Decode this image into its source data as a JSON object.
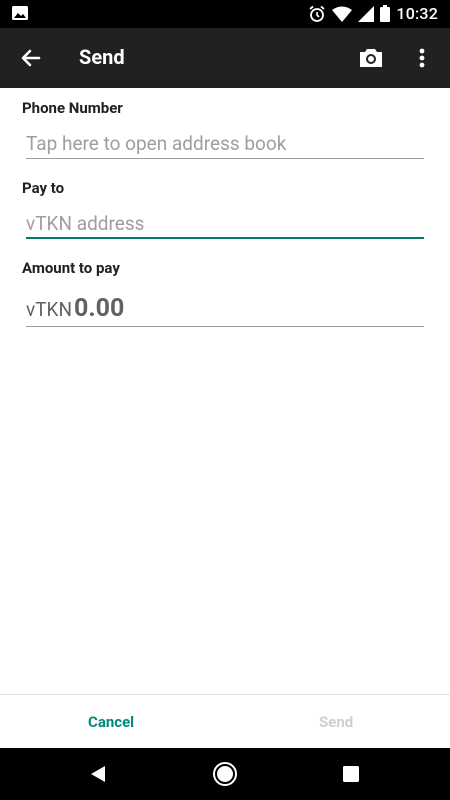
{
  "status_bar": {
    "time": "10:32",
    "icons": [
      "image-icon",
      "alarm-icon",
      "wifi-icon",
      "signal-icon",
      "battery-icon"
    ]
  },
  "app_bar": {
    "title": "Send",
    "icons": [
      "back-arrow-icon",
      "camera-icon",
      "more-vert-icon"
    ]
  },
  "form": {
    "phone_label": "Phone Number",
    "phone_placeholder": "Tap here to open address book",
    "pay_to_label": "Pay to",
    "pay_to_placeholder": "vTKN address",
    "amount_label": "Amount to pay",
    "amount_unit": "vTKN",
    "amount_value": "0.00"
  },
  "actions": {
    "cancel": "Cancel",
    "send": "Send"
  },
  "colors": {
    "accent": "#00897b",
    "app_bar": "#212121",
    "disabled": "#cfcfcf"
  }
}
